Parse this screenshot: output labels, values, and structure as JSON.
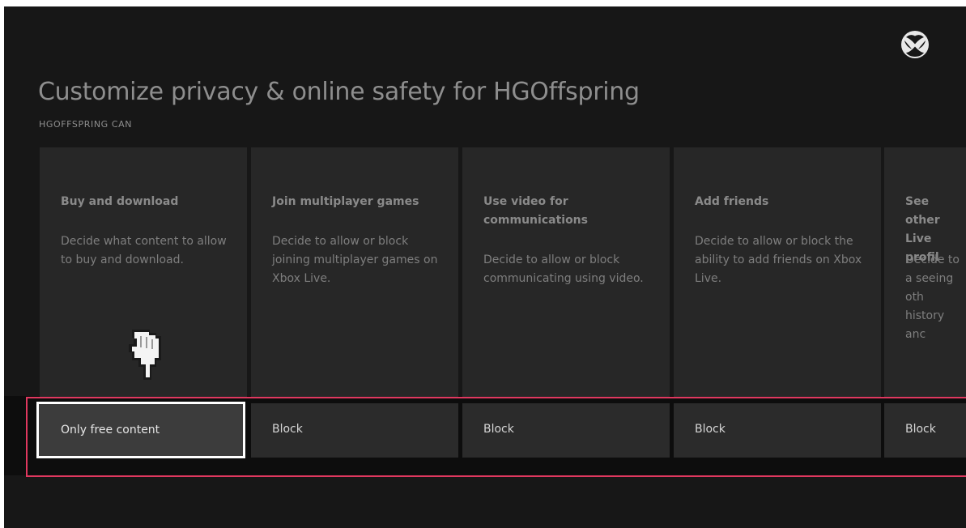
{
  "header": {
    "title": "Customize privacy & online safety for HGOffspring",
    "subtitle": "HGOFFSPRING CAN"
  },
  "logo": {
    "icon": "xbox-logo-icon"
  },
  "cards": [
    {
      "title": "Buy and download",
      "description": "Decide what content to allow to buy and download.",
      "option": "Only free content",
      "selected": true
    },
    {
      "title": "Join multiplayer games",
      "description": "Decide to allow or block joining multiplayer games on Xbox Live.",
      "option": "Block",
      "selected": false
    },
    {
      "title": "Use video for communications",
      "description": "Decide to allow or block communicating using video.",
      "option": "Block",
      "selected": false
    },
    {
      "title": "Add friends",
      "description": "Decide to allow or block the ability to add friends on Xbox Live.",
      "option": "Block",
      "selected": false
    },
    {
      "title": "See other Live profil",
      "description": "Decide to a seeing oth history anc",
      "option": "Block",
      "selected": false
    }
  ],
  "cursor": {
    "icon": "hand-pointer-icon"
  },
  "colors": {
    "background": "#171717",
    "card": "#272727",
    "highlight": "#e0385f",
    "selected_border": "#ffffff"
  }
}
